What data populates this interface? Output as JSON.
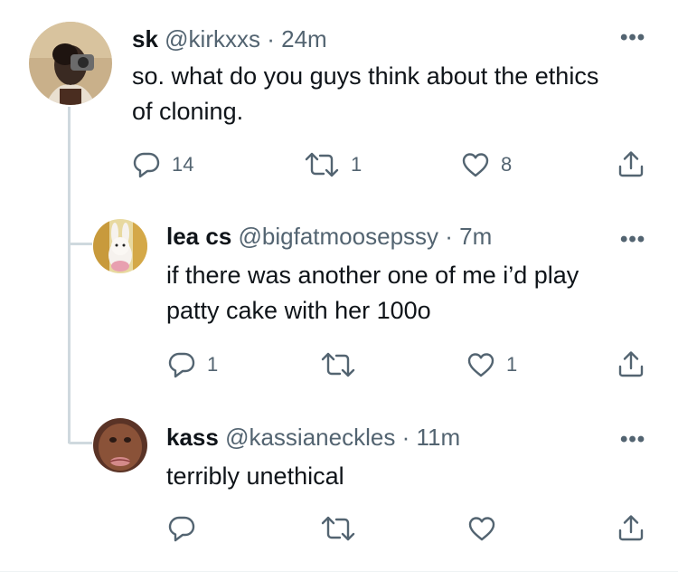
{
  "tweets": [
    {
      "name": "sk",
      "handle": "@kirkxxs",
      "separator": "·",
      "time": "24m",
      "text_lines": [
        "so. what do you guys think about the ethics",
        "of cloning."
      ],
      "replies": "14",
      "retweets": "1",
      "likes": "8"
    },
    {
      "name": "lea cs",
      "handle": "@bigfatmoosepssy",
      "separator": "·",
      "time": "7m",
      "text_lines": [
        "if there was another one of me i’d play",
        "patty cake with her 100o"
      ],
      "replies": "1",
      "retweets": "",
      "likes": "1"
    },
    {
      "name": "kass",
      "handle": "@kassianeckles",
      "separator": "·",
      "time": "11m",
      "text_lines": [
        "terribly unethical"
      ],
      "replies": "",
      "retweets": "",
      "likes": ""
    }
  ],
  "icons": {
    "reply": "reply-icon",
    "retweet": "retweet-icon",
    "like": "heart-icon",
    "share": "share-icon",
    "more": "more-icon"
  },
  "colors": {
    "text": "#0f1419",
    "muted": "#536471",
    "thread_line": "#cfd9de"
  }
}
